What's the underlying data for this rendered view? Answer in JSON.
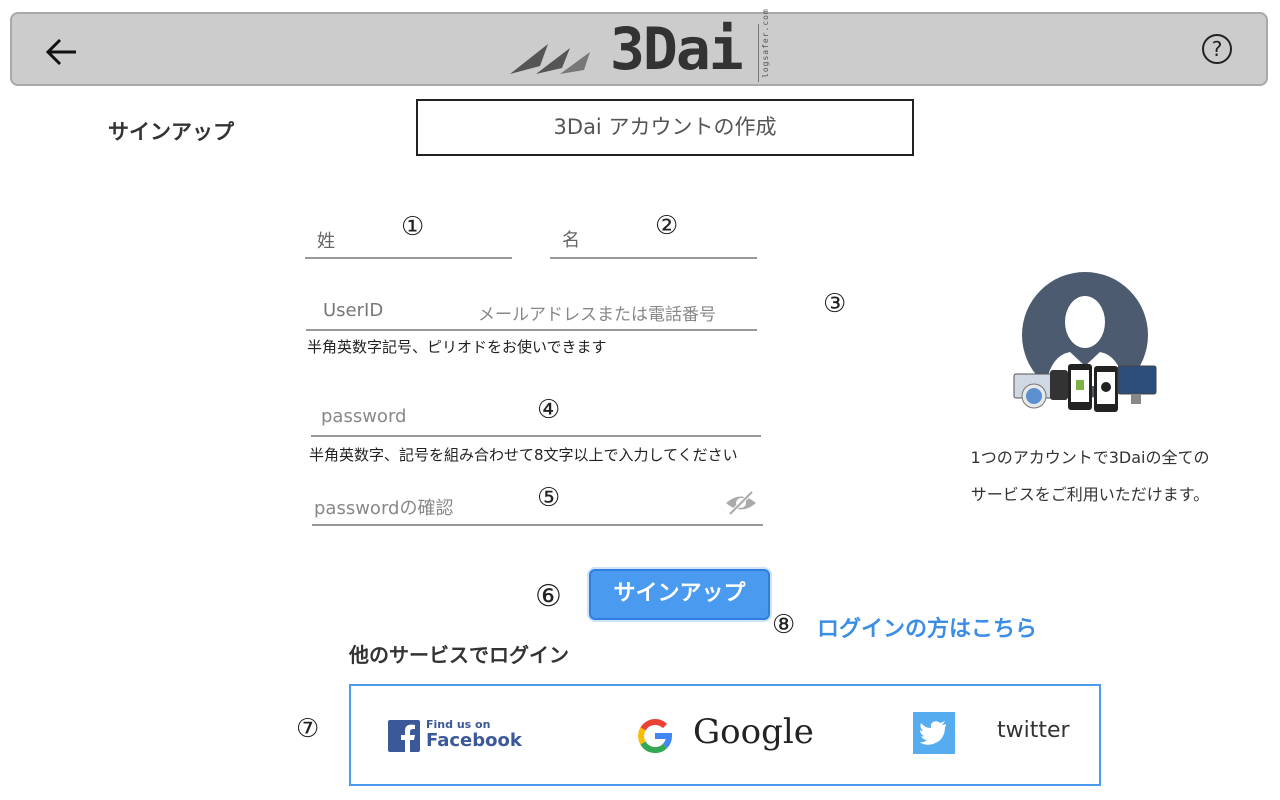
{
  "header": {
    "logo_text": "3Dai",
    "logo_subtext": "logsafer.com"
  },
  "page": {
    "section_title": "サインアップ",
    "main_title": "3Dai アカウントの作成"
  },
  "annotations": {
    "n1": "①",
    "n2": "②",
    "n3": "③",
    "n4": "④",
    "n5": "⑤",
    "n6": "⑥",
    "n7": "⑦",
    "n8": "⑧"
  },
  "form": {
    "last_name_label": "姓",
    "first_name_label": "名",
    "userid_label": "UserID",
    "userid_placeholder": "メールアドレスまたは電話番号",
    "userid_hint": "半角英数字記号、ピリオドをお使いできます",
    "password_placeholder": "password",
    "password_hint": "半角英数字、記号を組み合わせて8文字以上で入力してください",
    "password_confirm_placeholder": "passwordの確認",
    "signup_button": "サインアップ"
  },
  "login_link": "ログインの方はこちら",
  "other_login_title": "他のサービスでログイン",
  "social": {
    "facebook_small": "Find us on",
    "facebook_big": "Facebook",
    "google": "Google",
    "twitter": "twitter"
  },
  "side_panel": {
    "line1": "1つのアカウントで3Daiの全ての",
    "line2": "サービスをご利用いただけます。"
  },
  "colors": {
    "accent": "#4a9af0",
    "header_bg": "#cccccc",
    "facebook": "#3b5998",
    "twitter": "#55acee"
  }
}
